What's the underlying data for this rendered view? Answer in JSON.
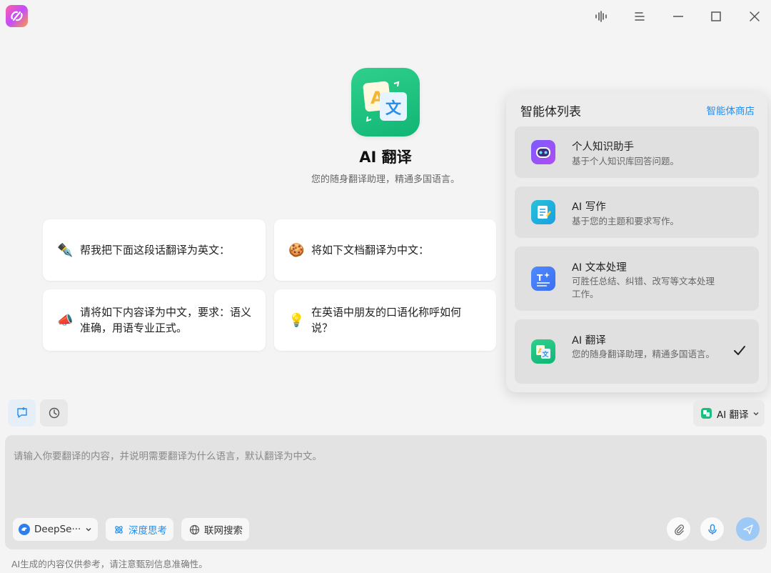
{
  "window": {
    "icons": [
      "app-logo-icon",
      "voice-wave-icon",
      "menu-icon",
      "minimize-icon",
      "maximize-icon",
      "close-icon"
    ]
  },
  "hero": {
    "title": "AI 翻译",
    "subtitle": "您的随身翻译助理，精通多国语言。"
  },
  "suggestions": [
    {
      "emoji": "✒️",
      "text": "帮我把下面这段话翻译为英文："
    },
    {
      "emoji": "🍪",
      "text": "将如下文档翻译为中文："
    },
    {
      "emoji": "📣",
      "text": "请将如下内容译为中文，要求：语义准确，用语专业正式。"
    },
    {
      "emoji": "💡",
      "text": "在英语中朋友的口语化称呼如何说？"
    }
  ],
  "agent_panel": {
    "title": "智能体列表",
    "store_link": "智能体商店",
    "agents": [
      {
        "name": "个人知识助手",
        "desc": "基于个人知识库回答问题。",
        "selected": false
      },
      {
        "name": "AI 写作",
        "desc": "基于您的主题和要求写作。",
        "selected": false
      },
      {
        "name": "AI 文本处理",
        "desc": "可胜任总结、纠错、改写等文本处理工作。",
        "selected": false
      },
      {
        "name": "AI 翻译",
        "desc": "您的随身翻译助理，精通多国语言。",
        "selected": true
      }
    ]
  },
  "agent_select": {
    "label": "AI 翻译"
  },
  "input": {
    "placeholder": "请输入你要翻译的内容，并说明需要翻译为什么语言，默认翻译为中文。",
    "value": ""
  },
  "toolbar": {
    "model": "DeepSe···",
    "deep_think": "深度思考",
    "web_search": "联网搜索"
  },
  "footer": {
    "disclaimer": "AI生成的内容仅供参考，请注意甄别信息准确性。"
  },
  "colors": {
    "accent": "#1f8ef0",
    "send": "#9cc9f5",
    "brand_green": "#1bbf7d"
  }
}
